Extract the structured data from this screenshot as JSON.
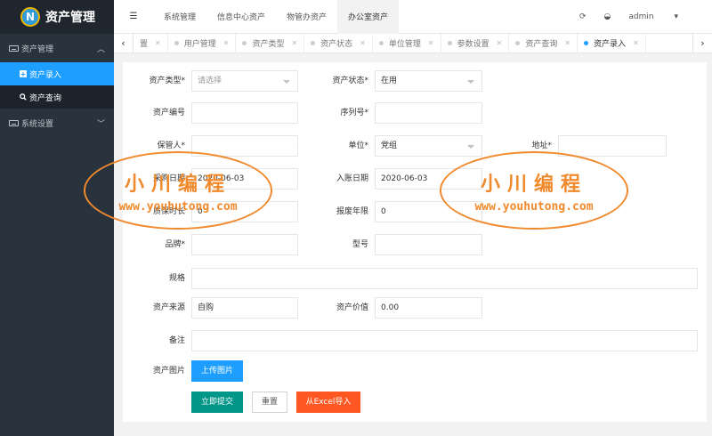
{
  "app": {
    "logo_letter": "N",
    "title": "资产管理"
  },
  "sidebar": {
    "groups": [
      {
        "label": "资产管理",
        "chevron": "^"
      },
      {
        "label": "系统设置",
        "chevron": "v"
      }
    ],
    "items": [
      {
        "label": "资产录入",
        "icon": "plus-square-icon"
      },
      {
        "label": "资产查询",
        "icon": "search-icon"
      }
    ]
  },
  "header": {
    "tabs": [
      "系统管理",
      "信息中心资产",
      "物管办资产",
      "办公室资产"
    ],
    "user": "admin",
    "menu_glyph": "☰",
    "refresh_glyph": "⟳",
    "theme_glyph": "◒",
    "dropdown_glyph": "▾"
  },
  "tabstrip": {
    "prev_glyph": "‹",
    "next_glyph": "›",
    "tabs": [
      "置",
      "用户管理",
      "资产类型",
      "资产状态",
      "单位管理",
      "参数设置",
      "资产查询",
      "资产录入"
    ],
    "close_glyph": "✕"
  },
  "form": {
    "labels": {
      "type": "资产类型*",
      "status": "资产状态*",
      "code": "资产编号",
      "serial": "序列号*",
      "keeper": "保管人*",
      "unit": "单位*",
      "address": "地址*",
      "purchase_date": "采购日期",
      "entry_date": "入账日期",
      "warranty": "质保时长",
      "scrap_years": "报废年限",
      "brand": "品牌*",
      "model": "型号",
      "spec": "规格",
      "source": "资产来源",
      "value": "资产价值",
      "remark": "备注",
      "image": "资产图片"
    },
    "values": {
      "type_placeholder": "请选择",
      "status": "在用",
      "unit": "党组",
      "purchase_date": "2020-06-03",
      "entry_date": "2020-06-03",
      "warranty": "0",
      "scrap_years": "0",
      "source": "自购",
      "value": "0.00"
    },
    "buttons": {
      "upload": "上传图片",
      "submit": "立即提交",
      "reset": "重置",
      "import": "从Excel导入"
    }
  },
  "watermark": {
    "title": "小川编程",
    "url": "www.youhutong.com"
  },
  "colors": {
    "accent": "#1e9fff",
    "submit": "#009688",
    "import": "#ff5722",
    "sidebar": "#28333e",
    "watermark": "#f08a2c"
  }
}
